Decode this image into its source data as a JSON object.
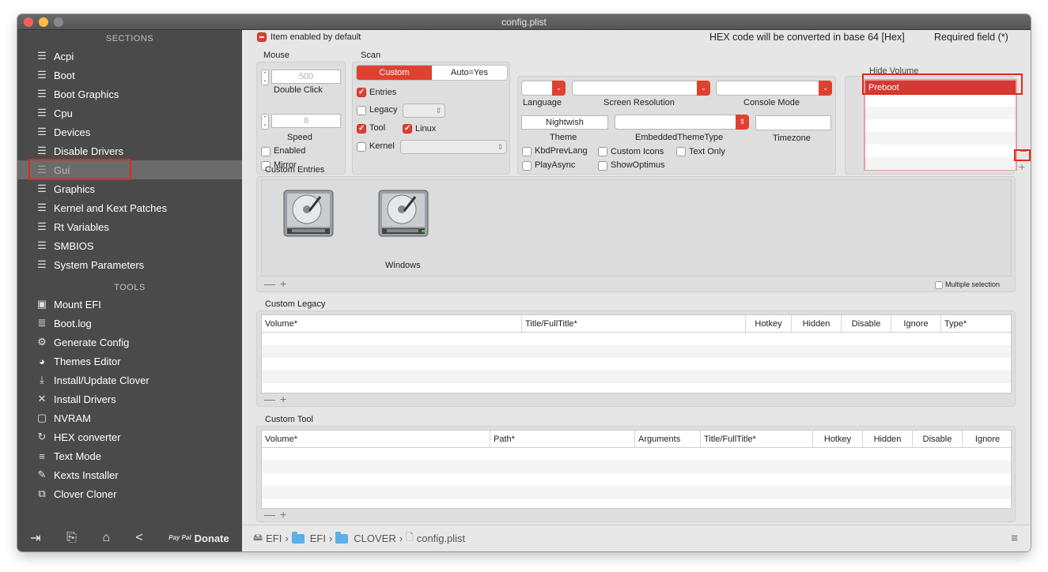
{
  "window": {
    "title": "config.plist"
  },
  "sidebar": {
    "sections_header": "SECTIONS",
    "sections": [
      {
        "label": "Acpi"
      },
      {
        "label": "Boot"
      },
      {
        "label": "Boot Graphics"
      },
      {
        "label": "Cpu"
      },
      {
        "label": "Devices"
      },
      {
        "label": "Disable Drivers"
      },
      {
        "label": "Gui"
      },
      {
        "label": "Graphics"
      },
      {
        "label": "Kernel and Kext Patches"
      },
      {
        "label": "Rt Variables"
      },
      {
        "label": "SMBIOS"
      },
      {
        "label": "System Parameters"
      }
    ],
    "tools_header": "TOOLS",
    "tools": [
      {
        "label": "Mount EFI",
        "icon": "disk-icon"
      },
      {
        "label": "Boot.log",
        "icon": "log-icon"
      },
      {
        "label": "Generate Config",
        "icon": "gears-icon"
      },
      {
        "label": "Themes Editor",
        "icon": "palette-icon"
      },
      {
        "label": "Install/Update Clover",
        "icon": "download-icon"
      },
      {
        "label": "Install Drivers",
        "icon": "tools-icon"
      },
      {
        "label": "NVRAM",
        "icon": "chip-icon"
      },
      {
        "label": "HEX converter",
        "icon": "refresh-icon"
      },
      {
        "label": "Text Mode",
        "icon": "lines-icon"
      },
      {
        "label": "Kexts Installer",
        "icon": "kext-icon"
      },
      {
        "label": "Clover Cloner",
        "icon": "clone-icon"
      }
    ],
    "footer": {
      "paypal": "Pay Pal",
      "donate": "Donate"
    }
  },
  "header": {
    "item_enabled": "Item enabled by default",
    "hex_note": "HEX code will be converted in base 64 [Hex]",
    "required": "Required field (*)"
  },
  "mouse": {
    "title": "Mouse",
    "double_click_value": "500",
    "double_click_label": "Double Click",
    "speed_value": "8",
    "speed_label": "Speed",
    "enabled": "Enabled",
    "mirror": "Mirror"
  },
  "scan": {
    "title": "Scan",
    "seg_custom": "Custom",
    "seg_auto": "Auto=Yes",
    "entries": "Entries",
    "legacy": "Legacy",
    "tool": "Tool",
    "linux": "Linux",
    "kernel": "Kernel"
  },
  "general": {
    "language": "Language",
    "screen_resolution": "Screen Resolution",
    "console_mode": "Console Mode",
    "theme_value": "Nightwish",
    "theme": "Theme",
    "embedded_theme_type": "EmbeddedThemeType",
    "timezone": "Timezone",
    "kbd_prev_lang": "KbdPrevLang",
    "custom_icons": "Custom Icons",
    "text_only": "Text Only",
    "play_async": "PlayAsync",
    "show_optimus": "ShowOptimus"
  },
  "hide_volume": {
    "title": "Hide Volume",
    "items": [
      "Preboot"
    ]
  },
  "custom_entries": {
    "title": "Custom Entries",
    "entries": [
      {
        "label": ""
      },
      {
        "label": "Windows"
      }
    ],
    "multiple_selection": "Multiple selection"
  },
  "custom_legacy": {
    "title": "Custom Legacy",
    "columns": [
      "Volume*",
      "Title/FullTitle*",
      "Hotkey",
      "Hidden",
      "Disable",
      "Ignore",
      "Type*"
    ]
  },
  "custom_tool": {
    "title": "Custom Tool",
    "columns": [
      "Volume*",
      "Path*",
      "Arguments",
      "Title/FullTitle*",
      "Hotkey",
      "Hidden",
      "Disable",
      "Ignore"
    ]
  },
  "controls": {
    "minus": "—",
    "plus": "+"
  },
  "pathbar": {
    "items": [
      "EFI",
      "EFI",
      "CLOVER",
      "config.plist"
    ],
    "sep": "›"
  },
  "colors": {
    "accent": "#e04030",
    "sidebar": "#4a4a4a",
    "highlight": "#e02a1a"
  }
}
